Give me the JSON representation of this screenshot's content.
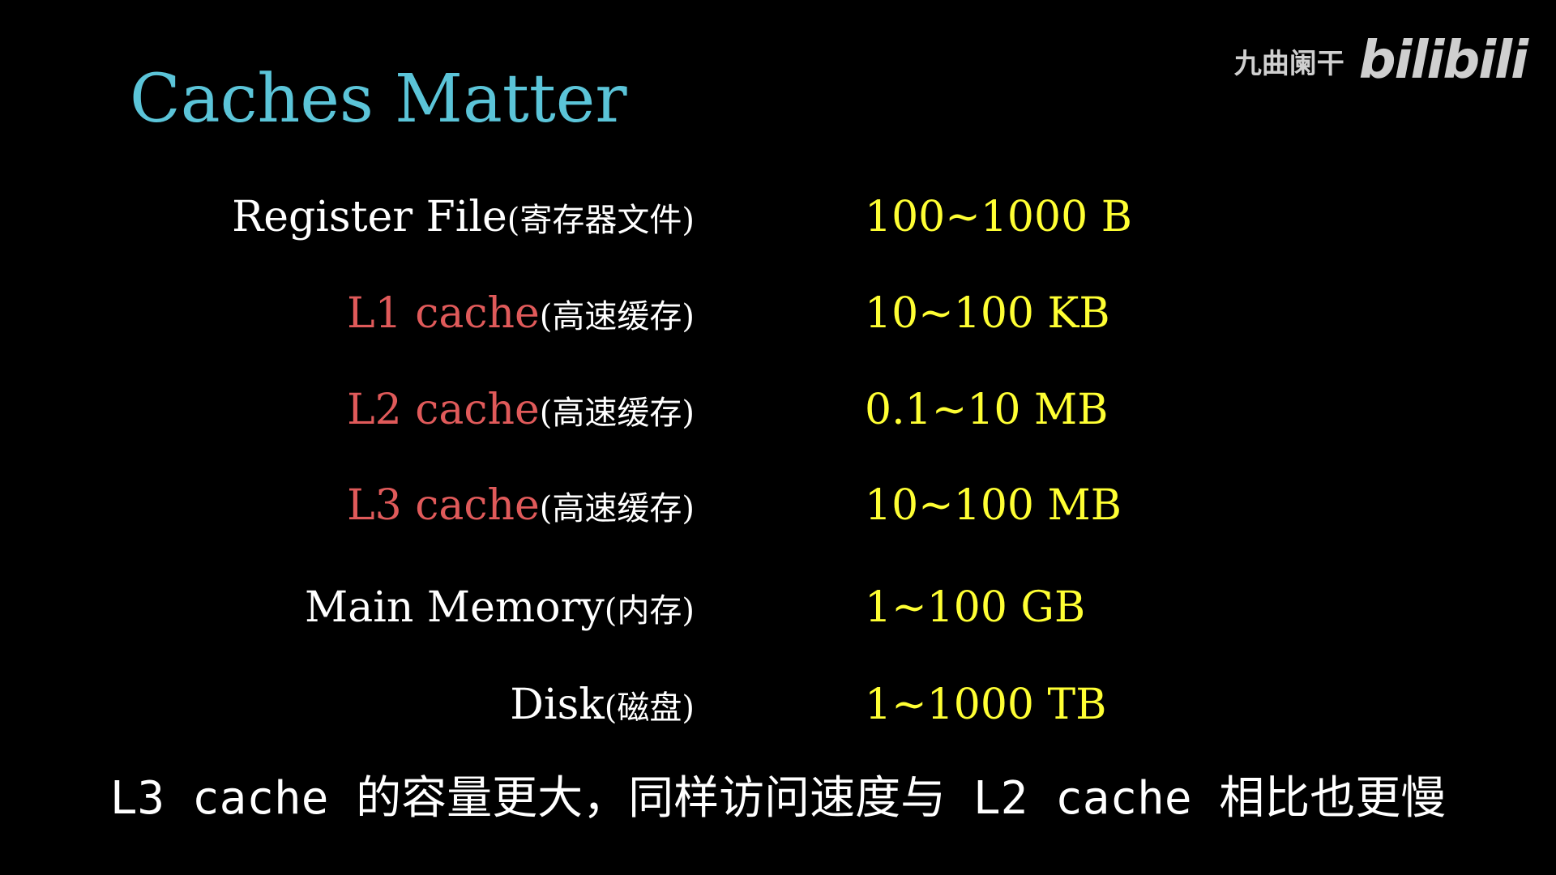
{
  "title": "Caches Matter",
  "watermark": {
    "author": "九曲阑干",
    "logo": "bilibili"
  },
  "colors": {
    "background": "#000000",
    "title": "#5bc4d8",
    "label_default": "#ffffff",
    "label_cache": "#e05a5a",
    "value": "#ffff33"
  },
  "rows": [
    {
      "label": "Register File",
      "label_cn": "(寄存器文件)",
      "value": "100~1000 B",
      "label_color": "#ffffff"
    },
    {
      "label": "L1 cache",
      "label_cn": "(高速缓存)",
      "value": "10~100 KB",
      "label_color": "#e05a5a"
    },
    {
      "label": "L2 cache",
      "label_cn": "(高速缓存)",
      "value": "0.1~10 MB",
      "label_color": "#e05a5a"
    },
    {
      "label": "L3 cache",
      "label_cn": "(高速缓存)",
      "value": "10~100 MB",
      "label_color": "#e05a5a"
    },
    {
      "label": "Main Memory",
      "label_cn": "(内存)",
      "value": "1~100 GB",
      "label_color": "#ffffff"
    },
    {
      "label": "Disk",
      "label_cn": "(磁盘)",
      "value": "1~1000 TB",
      "label_color": "#ffffff"
    }
  ],
  "subtitle": "L3 cache 的容量更大，同样访问速度与 L2 cache 相比也更慢"
}
